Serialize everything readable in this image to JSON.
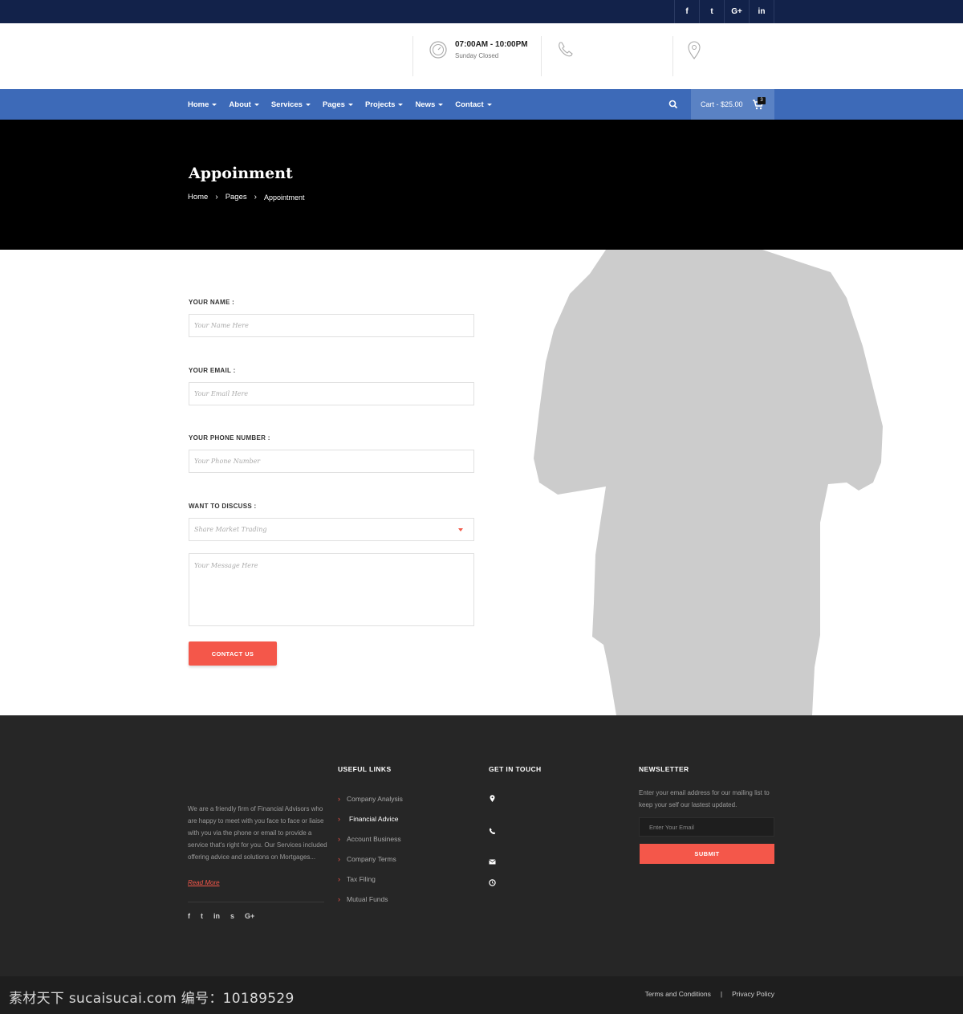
{
  "topbar": {
    "social": [
      {
        "icon": "facebook-icon",
        "glyph": "f"
      },
      {
        "icon": "twitter-icon",
        "glyph": "t"
      },
      {
        "icon": "google-plus-icon",
        "glyph": "G+"
      },
      {
        "icon": "linkedin-icon",
        "glyph": "in"
      }
    ]
  },
  "header": {
    "hours": {
      "title": "07:00AM - 10:00PM",
      "sub": "Sunday Closed",
      "icon": "clock-icon"
    },
    "phone": {
      "icon": "phone-icon"
    },
    "location": {
      "icon": "location-pin-icon"
    }
  },
  "nav": {
    "items": [
      "Home",
      "About",
      "Services",
      "Pages",
      "Projects",
      "News",
      "Contact"
    ],
    "cart_label": "Cart - $25.00",
    "cart_count": "3"
  },
  "banner": {
    "title": "Appoinment",
    "breadcrumb": [
      "Home",
      "Pages",
      "Appointment"
    ]
  },
  "form": {
    "name_label": "YOUR NAME :",
    "name_placeholder": "Your Name Here",
    "email_label": "YOUR EMAIL :",
    "email_placeholder": "Your Email Here",
    "phone_label": "YOUR PHONE NUMBER :",
    "phone_placeholder": "Your Phone Number",
    "discuss_label": "WANT TO DISCUSS :",
    "discuss_value": "Share Market Trading",
    "message_placeholder": "Your Message Here",
    "submit_label": "CONTACT US"
  },
  "footer": {
    "about_text": "We are a friendly firm of Financial Advisors who are happy to meet with you face to face or liaise with you via the phone or email to provide a service that's right for you. Our Services included offering advice and solutions on Mortgages...",
    "read_more": "Read More",
    "social": [
      "f",
      "t",
      "in",
      "s",
      "G+"
    ],
    "useful_links_heading": "USEFUL LINKS",
    "links": [
      "Company Analysis",
      "Financial Advice",
      "Account Business",
      "Company Terms",
      "Tax Filing",
      "Mutual Funds"
    ],
    "touch_heading": "GET IN TOUCH",
    "newsletter_heading": "NEWSLETTER",
    "newsletter_text": "Enter your email address for our mailing list to keep your self our lastest updated.",
    "newsletter_placeholder": "Enter Your Email",
    "submit_label": "SUBMIT"
  },
  "bottom": {
    "terms": "Terms and Conditions",
    "sep": "|",
    "privacy": "Privacy Policy",
    "watermark": "素材天下 sucaisucai.com  编号：10189529"
  },
  "colors": {
    "topbar": "#12224a",
    "nav": "#3d6ab8",
    "accent": "#f4574a",
    "footer": "#262626"
  }
}
